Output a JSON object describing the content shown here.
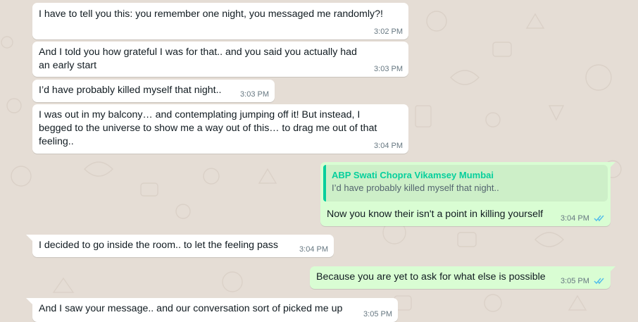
{
  "colors": {
    "wallpaper": "#e5ddd5",
    "incoming_bubble": "#ffffff",
    "outgoing_bubble": "#d9fdd3",
    "quote_author": "#06cf9c",
    "read_ticks": "#53bdeb",
    "timestamp": "#667781"
  },
  "messages": [
    {
      "text": "I have to tell you this: you remember one night, you messaged me randomly?!",
      "time": "3:02 PM"
    },
    {
      "text": "And I told you how grateful I was for that.. and you said you actually had an early start",
      "time": "3:03 PM"
    },
    {
      "text": "I’d have probably killed myself that night..",
      "time": "3:03 PM"
    },
    {
      "text": "I was out in my balcony… and contemplating jumping off it! But instead, I begged to the universe to show me a way out of this… to drag me out of that feeling..",
      "time": "3:04 PM"
    },
    {
      "quote": {
        "author": "ABP Swati Chopra Vikamsey Mumbai",
        "text": "I’d have probably killed myself that night.."
      },
      "text": "Now you know their isn't a point in killing yourself",
      "time": "3:04 PM",
      "status_icon": "double-check-icon"
    },
    {
      "text": "I decided to go inside the room.. to let the feeling pass",
      "time": "3:04 PM"
    },
    {
      "text": "Because you are yet to ask for what else is possible",
      "time": "3:05 PM",
      "status_icon": "double-check-icon"
    },
    {
      "text": "And I saw your message.. and our conversation sort of picked me up",
      "time": "3:05 PM"
    }
  ]
}
